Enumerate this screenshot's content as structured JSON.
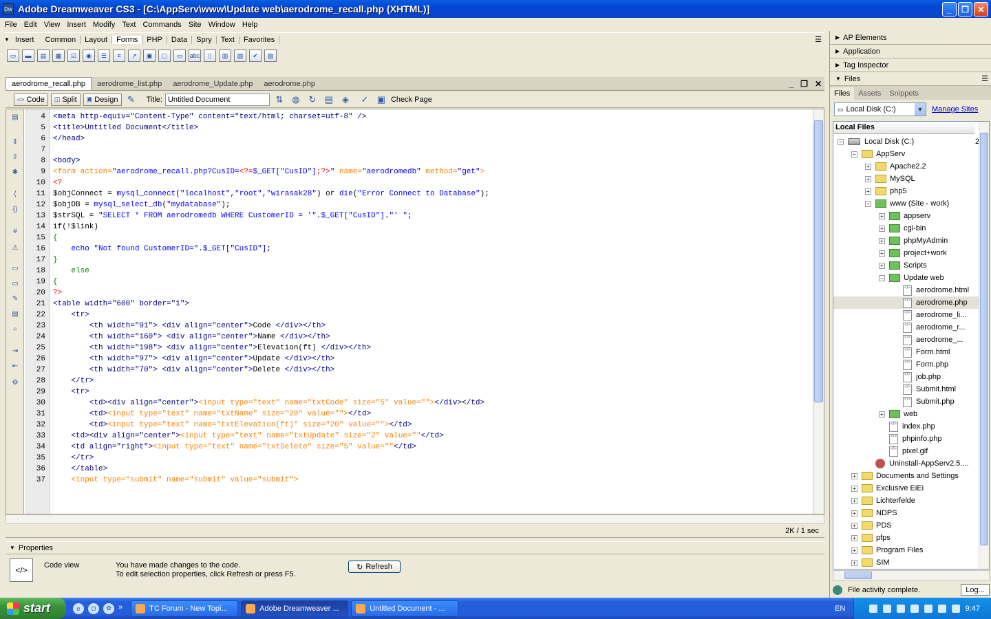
{
  "window": {
    "title": "Adobe Dreamweaver CS3 - [C:\\AppServ\\www\\Update web\\aerodrome_recall.php (XHTML)]",
    "app_icon": "Dw"
  },
  "menu": [
    "File",
    "Edit",
    "View",
    "Insert",
    "Modify",
    "Text",
    "Commands",
    "Site",
    "Window",
    "Help"
  ],
  "insertbar": {
    "header": "Insert",
    "tabs": [
      "Common",
      "Layout",
      "Forms",
      "PHP",
      "Data",
      "Spry",
      "Text",
      "Favorites"
    ],
    "active_tab": "Forms"
  },
  "doc_tabs": [
    "aerodrome_recall.php",
    "aerodrome_list.php",
    "aerodrome_Update.php",
    "aerodrome.php"
  ],
  "doc_toolbar": {
    "code": "Code",
    "split": "Split",
    "design": "Design",
    "title_label": "Title:",
    "title_value": "Untitled Document",
    "check_page": "Check Page"
  },
  "code_lines": [
    {
      "n": "4",
      "parts": [
        [
          "t",
          "<meta http-equiv=\"Content-Type\" content=\"text/html; charset=utf-8\" />"
        ]
      ]
    },
    {
      "n": "5",
      "parts": [
        [
          "t",
          "<title>Untitled Document</title>"
        ]
      ]
    },
    {
      "n": "6",
      "parts": [
        [
          "t",
          "</head>"
        ]
      ]
    },
    {
      "n": "7",
      "parts": []
    },
    {
      "n": "8",
      "parts": [
        [
          "t",
          "<body>"
        ]
      ]
    },
    {
      "n": "9",
      "parts": [
        [
          "o",
          "<form "
        ],
        [
          "a",
          "action="
        ],
        [
          "s",
          "\"aerodrome_recall.php?CusID="
        ],
        [
          "p",
          "<?="
        ],
        [
          "v",
          "$_GET"
        ],
        [
          "s",
          "[\"CusID\"]"
        ],
        [
          "p",
          ";?>"
        ],
        [
          "s",
          "\""
        ],
        [
          "a",
          " name="
        ],
        [
          "s",
          "\"aerodromedb\""
        ],
        [
          "a",
          " method="
        ],
        [
          "s",
          "\"get\""
        ],
        [
          "o",
          ">"
        ]
      ]
    },
    {
      "n": "10",
      "parts": [
        [
          "p",
          "<?"
        ]
      ]
    },
    {
      "n": "11",
      "parts": [
        [
          "k",
          "$objConnect = "
        ],
        [
          "f",
          "mysql_connect"
        ],
        [
          "k",
          "("
        ],
        [
          "s",
          "\"localhost\""
        ],
        [
          "k",
          ","
        ],
        [
          "s",
          "\"root\""
        ],
        [
          "k",
          ","
        ],
        [
          "s",
          "\"wirasak28\""
        ],
        [
          "k",
          ") or "
        ],
        [
          "f",
          "die"
        ],
        [
          "k",
          "("
        ],
        [
          "s",
          "\"Error Connect to Database\""
        ],
        [
          "k",
          ");"
        ]
      ]
    },
    {
      "n": "12",
      "parts": [
        [
          "k",
          "$objDB = "
        ],
        [
          "f",
          "mysql_select_db"
        ],
        [
          "k",
          "("
        ],
        [
          "s",
          "\"mydatabase\""
        ],
        [
          "k",
          ");"
        ]
      ]
    },
    {
      "n": "13",
      "parts": [
        [
          "k",
          "$strSQL = "
        ],
        [
          "s",
          "\"SELECT * FROM aerodromedb WHERE CustomerID = '\""
        ],
        [
          "k",
          "."
        ],
        [
          "v",
          "$_GET"
        ],
        [
          "s",
          "[\"CusID\"]"
        ],
        [
          "k",
          "."
        ],
        [
          "s",
          "\"' \""
        ],
        [
          "k",
          ";"
        ]
      ]
    },
    {
      "n": "14",
      "parts": [
        [
          "k",
          "if(!$link)"
        ]
      ]
    },
    {
      "n": "15",
      "parts": [
        [
          "g",
          "{"
        ]
      ]
    },
    {
      "n": "16",
      "parts": [
        [
          "k",
          "    "
        ],
        [
          "f",
          "echo "
        ],
        [
          "s",
          "\"Not found CustomerID=\""
        ],
        [
          "k",
          "."
        ],
        [
          "v",
          "$_GET"
        ],
        [
          "s",
          "[\"CusID\"]"
        ],
        [
          "k",
          ";"
        ]
      ]
    },
    {
      "n": "17",
      "parts": [
        [
          "g",
          "}"
        ]
      ]
    },
    {
      "n": "18",
      "parts": [
        [
          "g",
          "    else"
        ]
      ]
    },
    {
      "n": "19",
      "parts": [
        [
          "g",
          "{"
        ]
      ]
    },
    {
      "n": "20",
      "parts": [
        [
          "p",
          "?>"
        ]
      ]
    },
    {
      "n": "21",
      "parts": [
        [
          "t",
          "<table width=\"600\" border=\"1\">"
        ]
      ]
    },
    {
      "n": "22",
      "parts": [
        [
          "t",
          "    <tr>"
        ]
      ]
    },
    {
      "n": "23",
      "parts": [
        [
          "t",
          "        <th width=\"91\"> <div align=\"center\">"
        ],
        [
          "k",
          "Code "
        ],
        [
          "t",
          "</div></th>"
        ]
      ]
    },
    {
      "n": "24",
      "parts": [
        [
          "t",
          "        <th width=\"160\"> <div align=\"center\">"
        ],
        [
          "k",
          "Name "
        ],
        [
          "t",
          "</div></th>"
        ]
      ]
    },
    {
      "n": "25",
      "parts": [
        [
          "t",
          "        <th width=\"198\"> <div align=\"center\">"
        ],
        [
          "k",
          "Elevation(ft) "
        ],
        [
          "t",
          "</div></th>"
        ]
      ]
    },
    {
      "n": "26",
      "parts": [
        [
          "t",
          "        <th width=\"97\"> <div align=\"center\">"
        ],
        [
          "k",
          "Update "
        ],
        [
          "t",
          "</div></th>"
        ]
      ]
    },
    {
      "n": "27",
      "parts": [
        [
          "t",
          "        <th width=\"70\"> <div align=\"center\">"
        ],
        [
          "k",
          "Delete "
        ],
        [
          "t",
          "</div></th>"
        ]
      ]
    },
    {
      "n": "28",
      "parts": [
        [
          "t",
          "    </tr>"
        ]
      ]
    },
    {
      "n": "29",
      "parts": [
        [
          "t",
          "    <tr>"
        ]
      ]
    },
    {
      "n": "30",
      "parts": [
        [
          "t",
          "        <td><div align=\"center\">"
        ],
        [
          "o",
          "<input type=\"text\" name=\"txtCode\" size=\"5\" value=\"\">"
        ],
        [
          "t",
          "</div></td>"
        ]
      ]
    },
    {
      "n": "31",
      "parts": [
        [
          "t",
          "        <td>"
        ],
        [
          "o",
          "<input type=\"text\" name=\"txtName\" size=\"20\" value=\"\">"
        ],
        [
          "t",
          "</td>"
        ]
      ]
    },
    {
      "n": "32",
      "parts": [
        [
          "t",
          "        <td>"
        ],
        [
          "o",
          "<input type=\"text\" name=\"txtElevation(ft)\" size=\"20\" value=\"\">"
        ],
        [
          "t",
          "</td>"
        ]
      ]
    },
    {
      "n": "33",
      "parts": [
        [
          "t",
          "    <td><div align=\"center\">"
        ],
        [
          "o",
          "<input type=\"text\" name=\"txtUpdate\" size=\"2\" value=\"\""
        ],
        [
          "t",
          "</td>"
        ]
      ]
    },
    {
      "n": "34",
      "parts": [
        [
          "t",
          "    <td align=\"right\">"
        ],
        [
          "o",
          "<input type=\"text\" name=\"txtDelete\" size=\"5\" value=\"\""
        ],
        [
          "t",
          "</td>"
        ]
      ]
    },
    {
      "n": "35",
      "parts": [
        [
          "t",
          "    </tr>"
        ]
      ]
    },
    {
      "n": "36",
      "parts": [
        [
          "t",
          "    </table>"
        ]
      ]
    },
    {
      "n": "37",
      "parts": [
        [
          "o",
          "    <input type=\"submit\" name=\"submit\" value=\"submit\">"
        ]
      ]
    }
  ],
  "colors": {
    "tag": "#000088",
    "string": "#0000ff",
    "php": "#ff0000",
    "keyword": "#000000",
    "form": "#ff8000",
    "func": "#0000ff",
    "var": "#0000ff",
    "green": "#008000",
    "attr": "#ff8000"
  },
  "status": {
    "size_time": "2K / 1 sec"
  },
  "properties": {
    "header": "Properties",
    "code_view": "Code view",
    "msg1": "You have made changes to the code.",
    "msg2": "To edit selection properties, click Refresh or press F5.",
    "refresh": "Refresh"
  },
  "right_panels": {
    "ap_elements": "AP Elements",
    "application": "Application",
    "tag_inspector": "Tag Inspector",
    "files": "Files",
    "file_tabs": [
      "Files",
      "Assets",
      "Snippets"
    ],
    "disk": "Local Disk (C:)",
    "manage_sites": "Manage Sites",
    "local_files": "Local Files",
    "activity": "File activity complete.",
    "log": "Log..."
  },
  "tree": [
    {
      "label": "Local Disk (C:)",
      "depth": 0,
      "type": "drive",
      "pm": "-",
      "extra": "2"
    },
    {
      "label": "AppServ",
      "depth": 1,
      "type": "folder",
      "pm": "-"
    },
    {
      "label": "Apache2.2",
      "depth": 2,
      "type": "folder",
      "pm": "+"
    },
    {
      "label": "MySQL",
      "depth": 2,
      "type": "folder",
      "pm": "+"
    },
    {
      "label": "php5",
      "depth": 2,
      "type": "folder",
      "pm": "+"
    },
    {
      "label": "www (Site - work)",
      "depth": 2,
      "type": "site",
      "pm": "-"
    },
    {
      "label": "appserv",
      "depth": 3,
      "type": "site",
      "pm": "+"
    },
    {
      "label": "cgi-bin",
      "depth": 3,
      "type": "site",
      "pm": "+"
    },
    {
      "label": "phpMyAdmin",
      "depth": 3,
      "type": "site",
      "pm": "+"
    },
    {
      "label": "project+work",
      "depth": 3,
      "type": "site",
      "pm": "+"
    },
    {
      "label": "Scripts",
      "depth": 3,
      "type": "site",
      "pm": "+"
    },
    {
      "label": "Update web",
      "depth": 3,
      "type": "site",
      "pm": "-"
    },
    {
      "label": "aerodrome.html",
      "depth": 4,
      "type": "file"
    },
    {
      "label": "aerodrome.php",
      "depth": 4,
      "type": "file",
      "selected": true
    },
    {
      "label": "aerodrome_li...",
      "depth": 4,
      "type": "file"
    },
    {
      "label": "aerodrome_r...",
      "depth": 4,
      "type": "file"
    },
    {
      "label": "aerodrome_...",
      "depth": 4,
      "type": "file"
    },
    {
      "label": "Form.html",
      "depth": 4,
      "type": "file"
    },
    {
      "label": "Form.php",
      "depth": 4,
      "type": "file"
    },
    {
      "label": "job.php",
      "depth": 4,
      "type": "file"
    },
    {
      "label": "Submit.html",
      "depth": 4,
      "type": "file"
    },
    {
      "label": "Submit.php",
      "depth": 4,
      "type": "file"
    },
    {
      "label": "web",
      "depth": 3,
      "type": "site",
      "pm": "+"
    },
    {
      "label": "index.php",
      "depth": 3,
      "type": "file"
    },
    {
      "label": "phpinfo.php",
      "depth": 3,
      "type": "file"
    },
    {
      "label": "pixel.gif",
      "depth": 3,
      "type": "file"
    },
    {
      "label": "Uninstall-AppServ2.5....",
      "depth": 2,
      "type": "uninst"
    },
    {
      "label": "Documents and Settings",
      "depth": 1,
      "type": "folder",
      "pm": "+"
    },
    {
      "label": "Exclusive EiEi",
      "depth": 1,
      "type": "folder",
      "pm": "+"
    },
    {
      "label": "Lichterfelde",
      "depth": 1,
      "type": "folder",
      "pm": "+"
    },
    {
      "label": "NDPS",
      "depth": 1,
      "type": "folder",
      "pm": "+"
    },
    {
      "label": "PDS",
      "depth": 1,
      "type": "folder",
      "pm": "+"
    },
    {
      "label": "pfps",
      "depth": 1,
      "type": "folder",
      "pm": "+"
    },
    {
      "label": "Program Files",
      "depth": 1,
      "type": "folder",
      "pm": "+"
    },
    {
      "label": "SIM",
      "depth": 1,
      "type": "folder",
      "pm": "+"
    }
  ],
  "taskbar": {
    "start": "start",
    "tasks": [
      "TC Forum - New Topi...",
      "Adobe Dreamweaver ...",
      "Untitled Document - ..."
    ],
    "active_task": 1,
    "lang": "EN",
    "clock": "9:47"
  }
}
